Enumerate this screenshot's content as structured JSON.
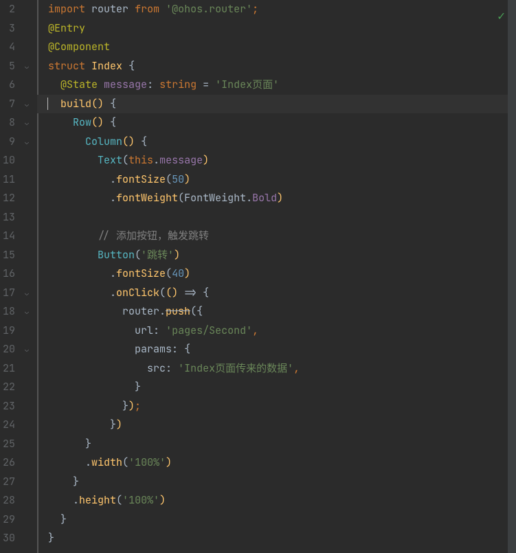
{
  "lines": [
    {
      "n": 2,
      "html": "<span class='kw'>import</span> <span class='id'>router</span> <span class='kw'>from</span> <span class='str'>'@ohos.router'</span><span class='punc'>;</span>"
    },
    {
      "n": 3,
      "html": "<span class='decorator'>@Entry</span>"
    },
    {
      "n": 4,
      "html": "<span class='decorator'>@Component</span>"
    },
    {
      "n": 5,
      "html": "<span class='kw'>struct</span> <span class='struct-id'>Index</span> <span class='brace'>{</span>"
    },
    {
      "n": 6,
      "html": "  <span class='decorator'>@State</span> <span class='prop'>message</span><span class='id'>:</span> <span class='kw'>string</span> <span class='id'>=</span> <span class='str'>'Index页面'</span>"
    },
    {
      "n": 7,
      "html": "<span class='caret'></span>  <span class='fn'>build</span><span class='paren-y'>()</span> <span class='brace'>{</span>",
      "hl": true
    },
    {
      "n": 8,
      "html": "    <span class='call-teal'>Row</span><span class='paren-y'>()</span> <span class='brace'>{</span>"
    },
    {
      "n": 9,
      "html": "      <span class='call-teal'>Column</span><span class='paren-y'>()</span> <span class='brace'>{</span>"
    },
    {
      "n": 10,
      "html": "        <span class='call-teal'>Text</span><span class='id'>(</span><span class='this'>this</span><span class='dot'>.</span><span class='prop'>message</span><span class='paren-y'>)</span>"
    },
    {
      "n": 11,
      "html": "          <span class='dot'>.</span><span class='fn'>fontSize</span><span class='id'>(</span><span class='num'>50</span><span class='paren-y'>)</span>"
    },
    {
      "n": 12,
      "html": "          <span class='dot'>.</span><span class='fn'>fontWeight</span><span class='id'>(</span><span class='id'>FontWeight</span><span class='dot'>.</span><span class='prop'>Bold</span><span class='paren-y'>)</span>"
    },
    {
      "n": 13,
      "html": ""
    },
    {
      "n": 14,
      "html": "        <span class='comment'>// 添加按钮，触发跳转</span>"
    },
    {
      "n": 15,
      "html": "        <span class='call-teal'>Button</span><span class='id'>(</span><span class='str'>'跳转'</span><span class='paren-y'>)</span>"
    },
    {
      "n": 16,
      "html": "          <span class='dot'>.</span><span class='fn'>fontSize</span><span class='id'>(</span><span class='num'>40</span><span class='paren-y'>)</span>"
    },
    {
      "n": 17,
      "html": "          <span class='dot'>.</span><span class='fn'>onClick</span><span class='id'>(</span><span class='paren-y'>()</span> <span class='id'>=&gt;</span> <span class='brace'>{</span>"
    },
    {
      "n": 18,
      "html": "            <span class='id'>router</span><span class='dot'>.</span><span class='fn strike'>push</span><span class='id'>(</span><span class='brace'>{</span>"
    },
    {
      "n": 19,
      "html": "              <span class='id'>url</span><span class='id'>:</span> <span class='str'>'pages/Second'</span><span class='punc'>,</span>"
    },
    {
      "n": 20,
      "html": "              <span class='id'>params</span><span class='id'>:</span> <span class='brace'>{</span>"
    },
    {
      "n": 21,
      "html": "                <span class='id'>src</span><span class='id'>:</span> <span class='str'>'Index页面传来的数据'</span><span class='punc'>,</span>"
    },
    {
      "n": 22,
      "html": "              <span class='brace'>}</span>"
    },
    {
      "n": 23,
      "html": "            <span class='brace'>}</span><span class='paren-y'>)</span><span class='punc'>;</span>"
    },
    {
      "n": 24,
      "html": "          <span class='brace'>}</span><span class='paren-y'>)</span>"
    },
    {
      "n": 25,
      "html": "      <span class='brace'>}</span>"
    },
    {
      "n": 26,
      "html": "      <span class='dot'>.</span><span class='fn'>width</span><span class='id'>(</span><span class='str'>'100%'</span><span class='paren-y'>)</span>"
    },
    {
      "n": 27,
      "html": "    <span class='brace'>}</span>"
    },
    {
      "n": 28,
      "html": "    <span class='dot'>.</span><span class='fn'>height</span><span class='id'>(</span><span class='str'>'100%'</span><span class='paren-y'>)</span>"
    },
    {
      "n": 29,
      "html": "  <span class='brace'>}</span>"
    },
    {
      "n": 30,
      "html": "<span class='brace'>}</span>"
    }
  ],
  "fold_marks": [
    5,
    7,
    8,
    9,
    17,
    18,
    20
  ],
  "status_icon": "✓"
}
